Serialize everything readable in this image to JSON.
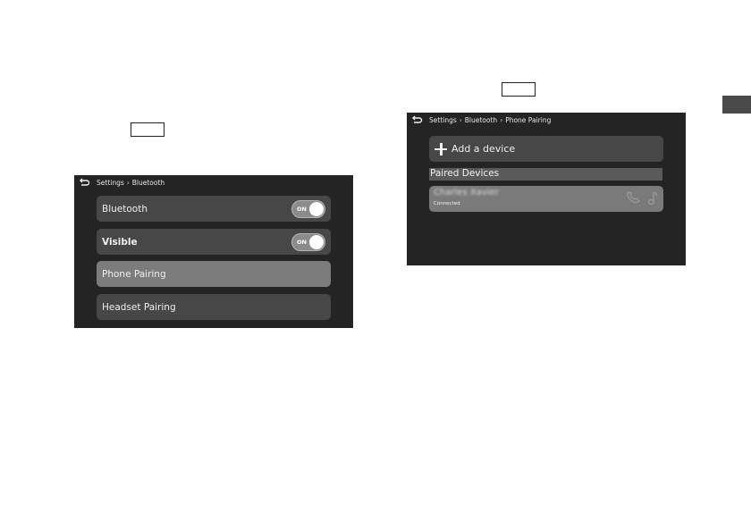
{
  "left_screen": {
    "breadcrumb": [
      "Settings",
      "Bluetooth"
    ],
    "items": [
      {
        "label": "Bluetooth",
        "toggle": "ON"
      },
      {
        "label": "Visible",
        "toggle": "ON"
      },
      {
        "label": "Phone Pairing"
      },
      {
        "label": "Headset Pairing"
      }
    ]
  },
  "right_screen": {
    "breadcrumb": [
      "Settings",
      "Bluetooth",
      "Phone Pairing"
    ],
    "add_device_label": "Add a device",
    "section_header": "Paired Devices",
    "device": {
      "name": "Charles Xavier",
      "status": "Connected",
      "icons": [
        "phone-icon",
        "music-note-icon"
      ]
    }
  },
  "colors": {
    "screen_bg": "#242424",
    "row_bg": "#474747",
    "row_selected": "#7c7c7c",
    "toggle_bg": "#8b8b8b",
    "side_tab": "#4a4a4a"
  }
}
